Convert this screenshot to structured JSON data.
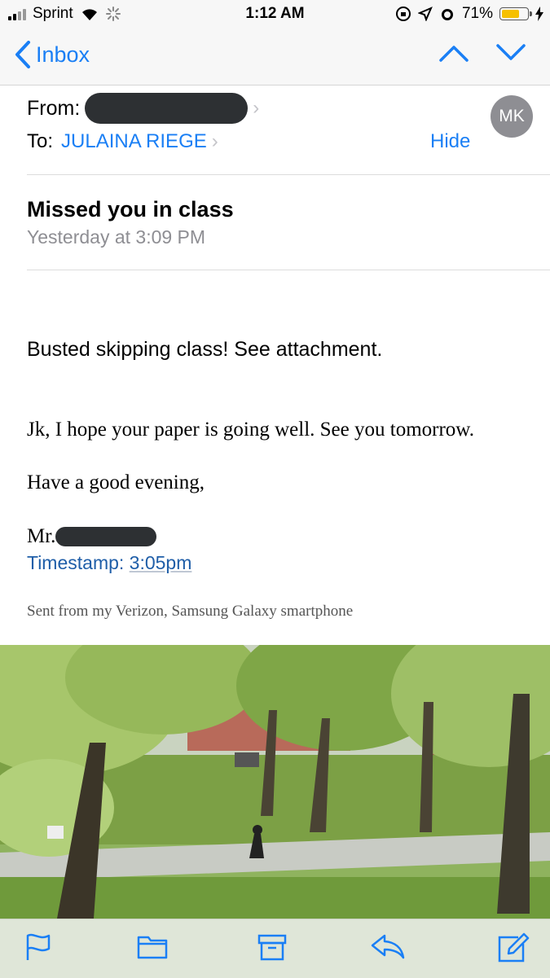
{
  "status_bar": {
    "carrier": "Sprint",
    "time": "1:12 AM",
    "battery_percent": "71%",
    "battery_level": 0.71
  },
  "nav": {
    "back_label": "Inbox"
  },
  "header": {
    "from_label": "From:",
    "to_label": "To:",
    "to_name": "JULAINA RIEGE",
    "hide_label": "Hide",
    "avatar_initials": "MK",
    "subject": "Missed you in class",
    "date": "Yesterday at 3:09 PM"
  },
  "body": {
    "line1": "Busted skipping class! See attachment.",
    "line2": "Jk, I hope your paper is going well. See you tomorrow.",
    "line3": "Have a good evening,",
    "signoff_prefix": "Mr.",
    "timestamp_label": "Timestamp:",
    "timestamp_value": "3:05pm",
    "footer": "Sent from my Verizon, Samsung Galaxy smartphone"
  },
  "colors": {
    "accent": "#1a7ff5",
    "toolbar_bg": "#dfe6d8",
    "avatar_bg": "#8e8e93"
  },
  "toolbar": {
    "icons": [
      "flag-icon",
      "folder-icon",
      "archive-icon",
      "reply-icon",
      "compose-icon"
    ]
  }
}
